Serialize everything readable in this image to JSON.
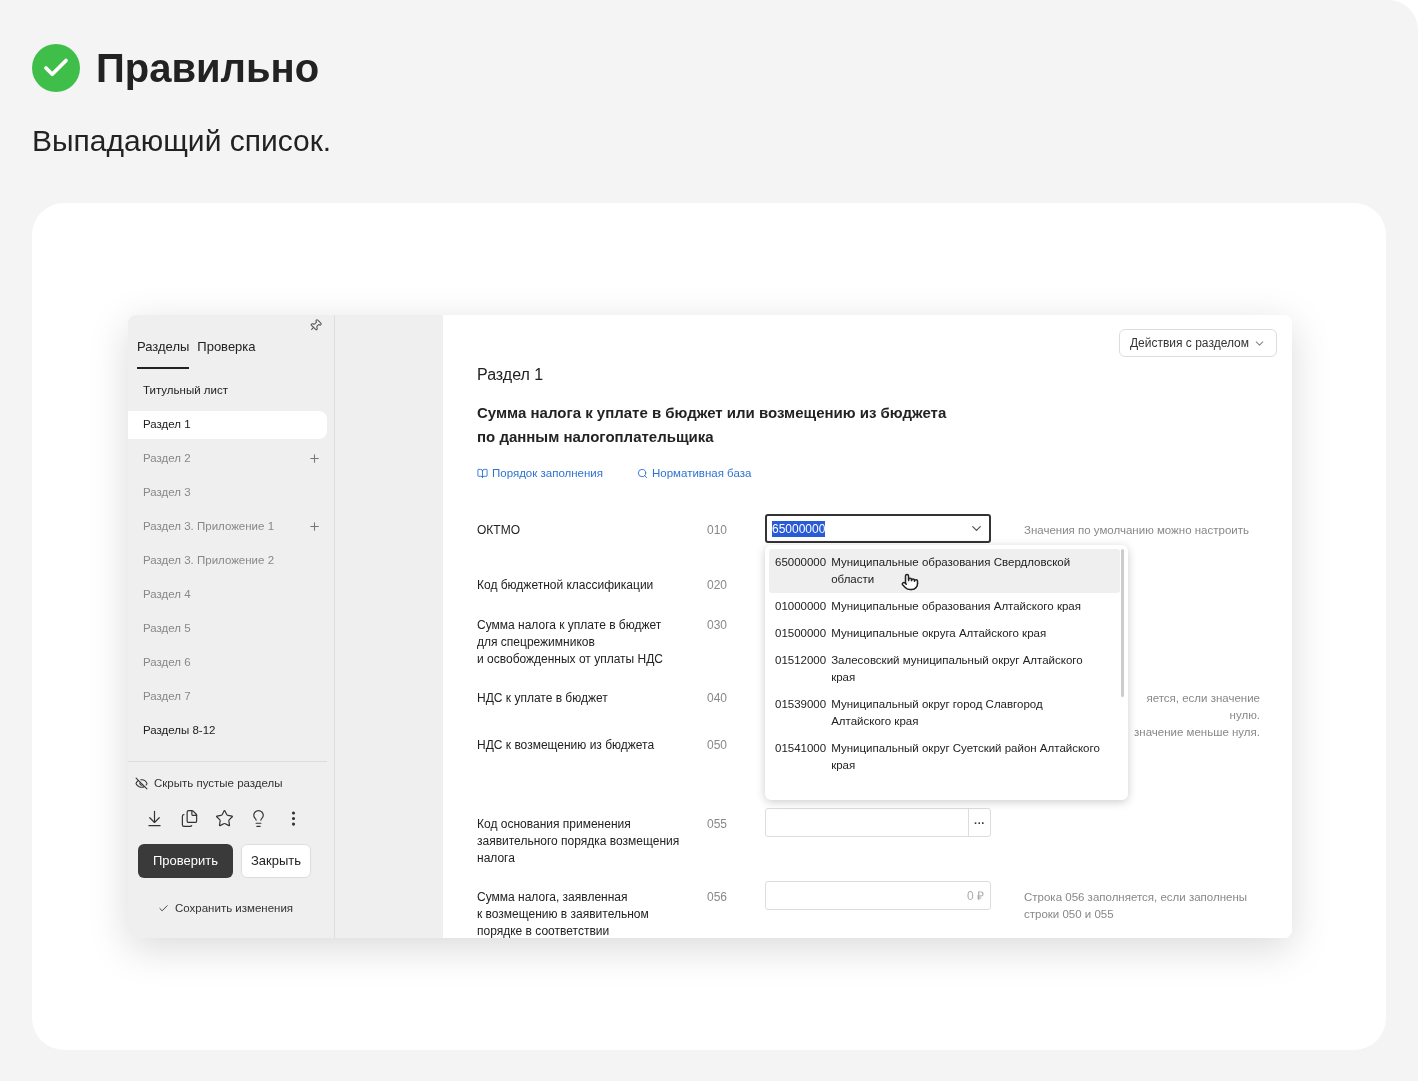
{
  "header": {
    "title": "Правильно",
    "subtitle": "Выпадающий список."
  },
  "sidebar": {
    "tabs": [
      {
        "label": "Разделы",
        "selected": true
      },
      {
        "label": "Проверка",
        "selected": false
      }
    ],
    "items": [
      {
        "label": "Титульный лист",
        "selected": false,
        "filled": true,
        "addable": false
      },
      {
        "label": "Раздел 1",
        "selected": true,
        "filled": true,
        "addable": false
      },
      {
        "label": "Раздел 2",
        "selected": false,
        "filled": false,
        "addable": true
      },
      {
        "label": "Раздел 3",
        "selected": false,
        "filled": false,
        "addable": false
      },
      {
        "label": "Раздел 3. Приложение 1",
        "selected": false,
        "filled": false,
        "addable": true
      },
      {
        "label": "Раздел 3. Приложение 2",
        "selected": false,
        "filled": false,
        "addable": false
      },
      {
        "label": "Раздел 4",
        "selected": false,
        "filled": false,
        "addable": false
      },
      {
        "label": "Раздел 5",
        "selected": false,
        "filled": false,
        "addable": false
      },
      {
        "label": "Раздел 6",
        "selected": false,
        "filled": false,
        "addable": false
      },
      {
        "label": "Раздел 7",
        "selected": false,
        "filled": false,
        "addable": false
      },
      {
        "label": "Разделы 8-12",
        "selected": false,
        "filled": true,
        "addable": false
      }
    ],
    "hide_empty": "Скрыть пустые разделы",
    "check_button": "Проверить",
    "close_button": "Закрыть",
    "save": "Сохранить изменения"
  },
  "main": {
    "actions_button": "Действия с разделом",
    "section": "Раздел 1",
    "title": "Сумма налога к уплате в бюджет или возмещению из бюджета\nпо данным налогоплательщика",
    "links": [
      {
        "kind": "book",
        "label": "Порядок заполнения"
      },
      {
        "kind": "search",
        "label": "Нормативная база"
      }
    ],
    "rows": [
      {
        "kind": "select",
        "label": "ОКТМО",
        "code": "010",
        "value": "65000000",
        "hint": [
          "Значения по умолчанию можно настроить"
        ]
      },
      {
        "kind": "none",
        "label": "Код бюджетной классификации",
        "code": "020"
      },
      {
        "kind": "none",
        "label": "Сумма налога к уплате в бюджет\nдля спецрежимников\nи освобожденных от уплаты НДС",
        "code": "030"
      },
      {
        "kind": "none",
        "label": "НДС к уплате в бюджет",
        "code": "040",
        "hint": [
          "яется, если значение",
          "нулю.",
          "значение меньше нуля."
        ]
      },
      {
        "kind": "none",
        "label": "НДС к возмещению из бюджета",
        "code": "050"
      },
      {
        "kind": "picker",
        "label": "Код основания применения\nзаявительного порядка возмещения\nналога",
        "code": "055",
        "button": "···"
      },
      {
        "kind": "amount",
        "label": "Сумма налога, заявленная\nк возмещению в заявительном\nпорядке в соответствии",
        "code": "056",
        "placeholder": "0 ₽",
        "hint": [
          "Строка 056 заполняется, если заполнены",
          "строки 050 и 055"
        ]
      }
    ],
    "dropdown": [
      {
        "code": "65000000",
        "name": "Муниципальные образования Свердловской\nобласти",
        "selected": true
      },
      {
        "code": "01000000",
        "name": "Муниципальные образования Алтайского края",
        "selected": false
      },
      {
        "code": "01500000",
        "name": "Муниципальные округа Алтайского края",
        "selected": false
      },
      {
        "code": "01512000",
        "name": "Залесовский муниципальный округ Алтайского\nкрая",
        "selected": false
      },
      {
        "code": "01539000",
        "name": "Муниципальный округ город Славгород\nАлтайского края",
        "selected": false
      },
      {
        "code": "01541000",
        "name": "Муниципальный округ Суетский район Алтайского\nкрая",
        "selected": false
      }
    ]
  }
}
